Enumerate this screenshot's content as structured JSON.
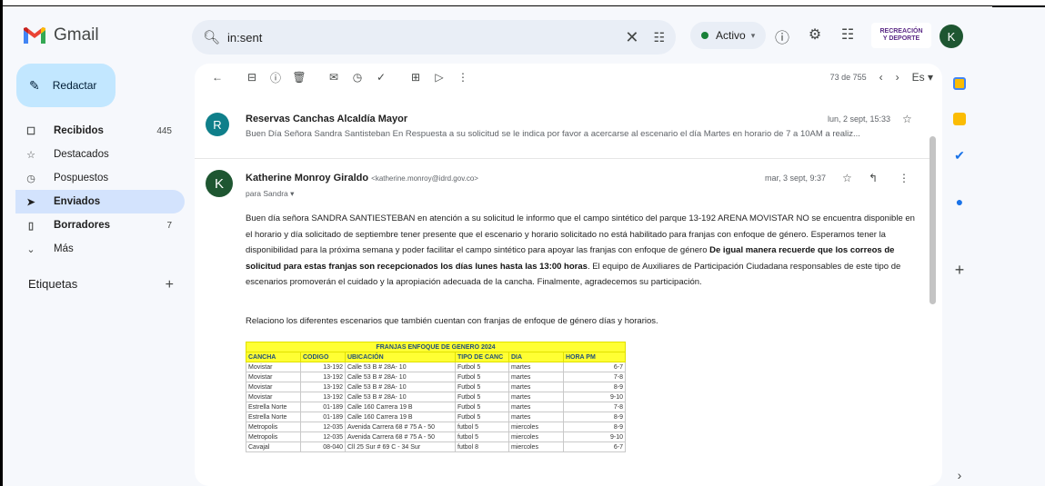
{
  "app": {
    "name": "Gmail"
  },
  "search": {
    "value": "in:sent"
  },
  "status": {
    "label": "Activo"
  },
  "org": {
    "line1": "RECREACIÓN",
    "line2": "Y DEPORTE"
  },
  "user": {
    "initial": "K"
  },
  "sidebar": {
    "compose_label": "Redactar",
    "items": [
      {
        "label": "Recibidos",
        "count": "445"
      },
      {
        "label": "Destacados",
        "count": ""
      },
      {
        "label": "Pospuestos",
        "count": ""
      },
      {
        "label": "Enviados",
        "count": ""
      },
      {
        "label": "Borradores",
        "count": "7"
      },
      {
        "label": "Más",
        "count": ""
      }
    ],
    "labels_title": "Etiquetas"
  },
  "toolbar": {
    "page_info": "73 de 755",
    "lang": "Es"
  },
  "messages": [
    {
      "initial": "R",
      "avatar_color": "#0f7f8a",
      "sender": "Reservas Canchas Alcaldía Mayor",
      "snippet": "Buen Día Señora Sandra Santisteban En Respuesta a su solicitud se le indica por favor a acercarse al escenario el día Martes en horario de 7 a 10AM a realiz...",
      "date": "lun, 2 sept, 15:33"
    },
    {
      "initial": "K",
      "avatar_color": "#1e5631",
      "sender": "Katherine Monroy Giraldo",
      "email": "<katherine.monroy@idrd.gov.co>",
      "to": "para Sandra",
      "date": "mar, 3 sept, 9:37",
      "body_1": "Buen día señora SANDRA SANTIESTEBAN en atención a su solicitud le informo que el campo sintético del parque 13-192  ARENA MOVISTAR  NO se encuentra disponible en el horario y día solicitado de septiembre tener presente que el escenario y horario solicitado no está habilitado para  franjas con enfoque de género.   Esperamos tener la disponibilidad para la próxima semana y poder  facilitar el campo sintético  para apoyar  las franjas con enfoque de género ",
      "body_bold": "De igual manera recuerde  que los correos de solicitud para estas franjas son recepcionados los días lunes hasta las 13:00 horas",
      "body_2": ". El equipo de Auxiliares de Participación Ciudadana responsables de este tipo de escenarios  promoverán el cuidado y la apropiación adecuada de la cancha. Finalmente, agradecemos su participación.",
      "relacion": "Relaciono los diferentes escenarios que también cuentan con franjas de enfoque de género  días y horarios."
    }
  ],
  "table": {
    "title": "FRANJAS ENFOQUE DE GENERO 2024",
    "headers": [
      "CANCHA",
      "CODIGO",
      "UBICACIÓN",
      "TIPO DE CANC",
      "DIA",
      "HORA PM"
    ],
    "rows": [
      [
        "Movistar",
        "13-192",
        "Calle 53 B # 28A- 10",
        "Futbol 5",
        "martes",
        "6-7"
      ],
      [
        "Movistar",
        "13-192",
        "Calle 53 B # 28A- 10",
        "Futbol 5",
        "martes",
        "7-8"
      ],
      [
        "Movistar",
        "13-192",
        "Calle 53 B # 28A- 10",
        "Futbol 5",
        "martes",
        "8-9"
      ],
      [
        "Movistar",
        "13-192",
        "Calle 53 B # 28A- 10",
        "Futbol 5",
        "martes",
        "9-10"
      ],
      [
        "Estrella Norte",
        "01-189",
        "Calle 160 Carrera 19 B",
        "Futbol 5",
        "martes",
        "7-8"
      ],
      [
        "Estrella Norte",
        "01-189",
        "Calle 160 Carrera 19 B",
        "Futbol 5",
        "martes",
        "8-9"
      ],
      [
        "Metropolis",
        "12-035",
        "Avenida Carrera 68 # 75 A - 50",
        "futbol 5",
        "miercoles",
        "8-9"
      ],
      [
        "Metropolis",
        "12-035",
        "Avenida Carrera 68 # 75 A - 50",
        "futbol 5",
        "miercoles",
        "9-10"
      ],
      [
        "Cavajal",
        "08-040",
        "Cll 25 Sur # 69 C - 34 Sur",
        "futbol 8",
        "miercoles",
        "6-7"
      ]
    ]
  }
}
